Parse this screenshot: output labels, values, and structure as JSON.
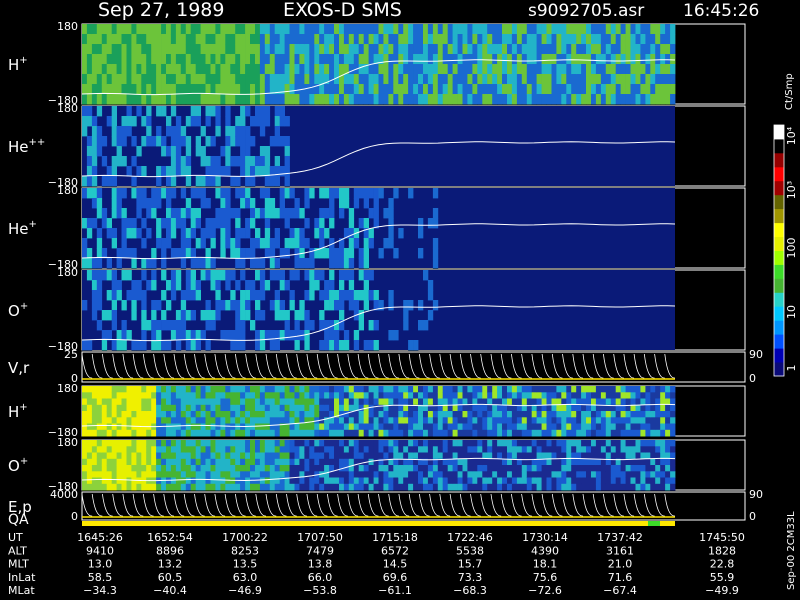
{
  "header": {
    "date": "Sep 27, 1989",
    "instrument": "EXOS-D SMS",
    "file": "s9092705.asr",
    "time": "16:45:26"
  },
  "chart_data": {
    "type": "heatmap",
    "colorbar": {
      "label": "Ct/Smp",
      "ticks": [
        "1",
        "10",
        "100",
        "10³",
        "10⁴"
      ],
      "colors": [
        "#0a0a78",
        "#0000b4",
        "#0050ff",
        "#0096ff",
        "#00c8ff",
        "#28d2c8",
        "#46b432",
        "#3cdc28",
        "#a0ff00",
        "#e6f000",
        "#ffff00",
        "#a09600",
        "#646400",
        "#a00000",
        "#ff0000",
        "#960000",
        "#000000",
        "#ffffff"
      ]
    },
    "panels": [
      {
        "label": "H",
        "sup": "+",
        "ytop": "180",
        "ybot": "−180",
        "kind": "spectrogram"
      },
      {
        "label": "He",
        "sup": "++",
        "ytop": "180",
        "ybot": "−180",
        "kind": "spectrogram"
      },
      {
        "label": "He",
        "sup": "+",
        "ytop": "180",
        "ybot": "−180",
        "kind": "spectrogram"
      },
      {
        "label": "O",
        "sup": "+",
        "ytop": "180",
        "ybot": "−180",
        "kind": "spectrogram"
      },
      {
        "label": "V,r",
        "sup": "",
        "ytop": "25",
        "ybot": "0",
        "rtop": "90",
        "rbot": "0",
        "kind": "line"
      },
      {
        "label": "H",
        "sup": "+",
        "ytop": "180",
        "ybot": "−180",
        "kind": "spectrogram"
      },
      {
        "label": "O",
        "sup": "+",
        "ytop": "180",
        "ybot": "−180",
        "kind": "spectrogram"
      },
      {
        "label": "E,p",
        "sup": "",
        "ytop": "4000",
        "ybot": "0",
        "rtop": "90",
        "rbot": "0",
        "kind": "line"
      }
    ],
    "qa_label": "QA",
    "side_label": "Sep-00 2CM33L",
    "orbit_table": {
      "rows": [
        {
          "name": "UT",
          "values": [
            "1645:26",
            "1652:54",
            "1700:22",
            "1707:50",
            "1715:18",
            "1722:46",
            "1730:14",
            "1737:42",
            "1745:50"
          ]
        },
        {
          "name": "ALT",
          "values": [
            "9410",
            "8896",
            "8253",
            "7479",
            "6572",
            "5538",
            "4390",
            "3161",
            "1828"
          ]
        },
        {
          "name": "MLT",
          "values": [
            "13.0",
            "13.2",
            "13.5",
            "13.8",
            "14.5",
            "15.7",
            "18.1",
            "21.0",
            "22.8"
          ]
        },
        {
          "name": "InLat",
          "values": [
            "58.5",
            "60.5",
            "63.0",
            "66.0",
            "69.6",
            "73.3",
            "75.6",
            "71.6",
            "55.9"
          ]
        },
        {
          "name": "MLat",
          "values": [
            "−34.3",
            "−40.4",
            "−46.9",
            "−53.8",
            "−61.1",
            "−68.3",
            "−72.6",
            "−67.4",
            "−49.9"
          ]
        }
      ]
    }
  }
}
